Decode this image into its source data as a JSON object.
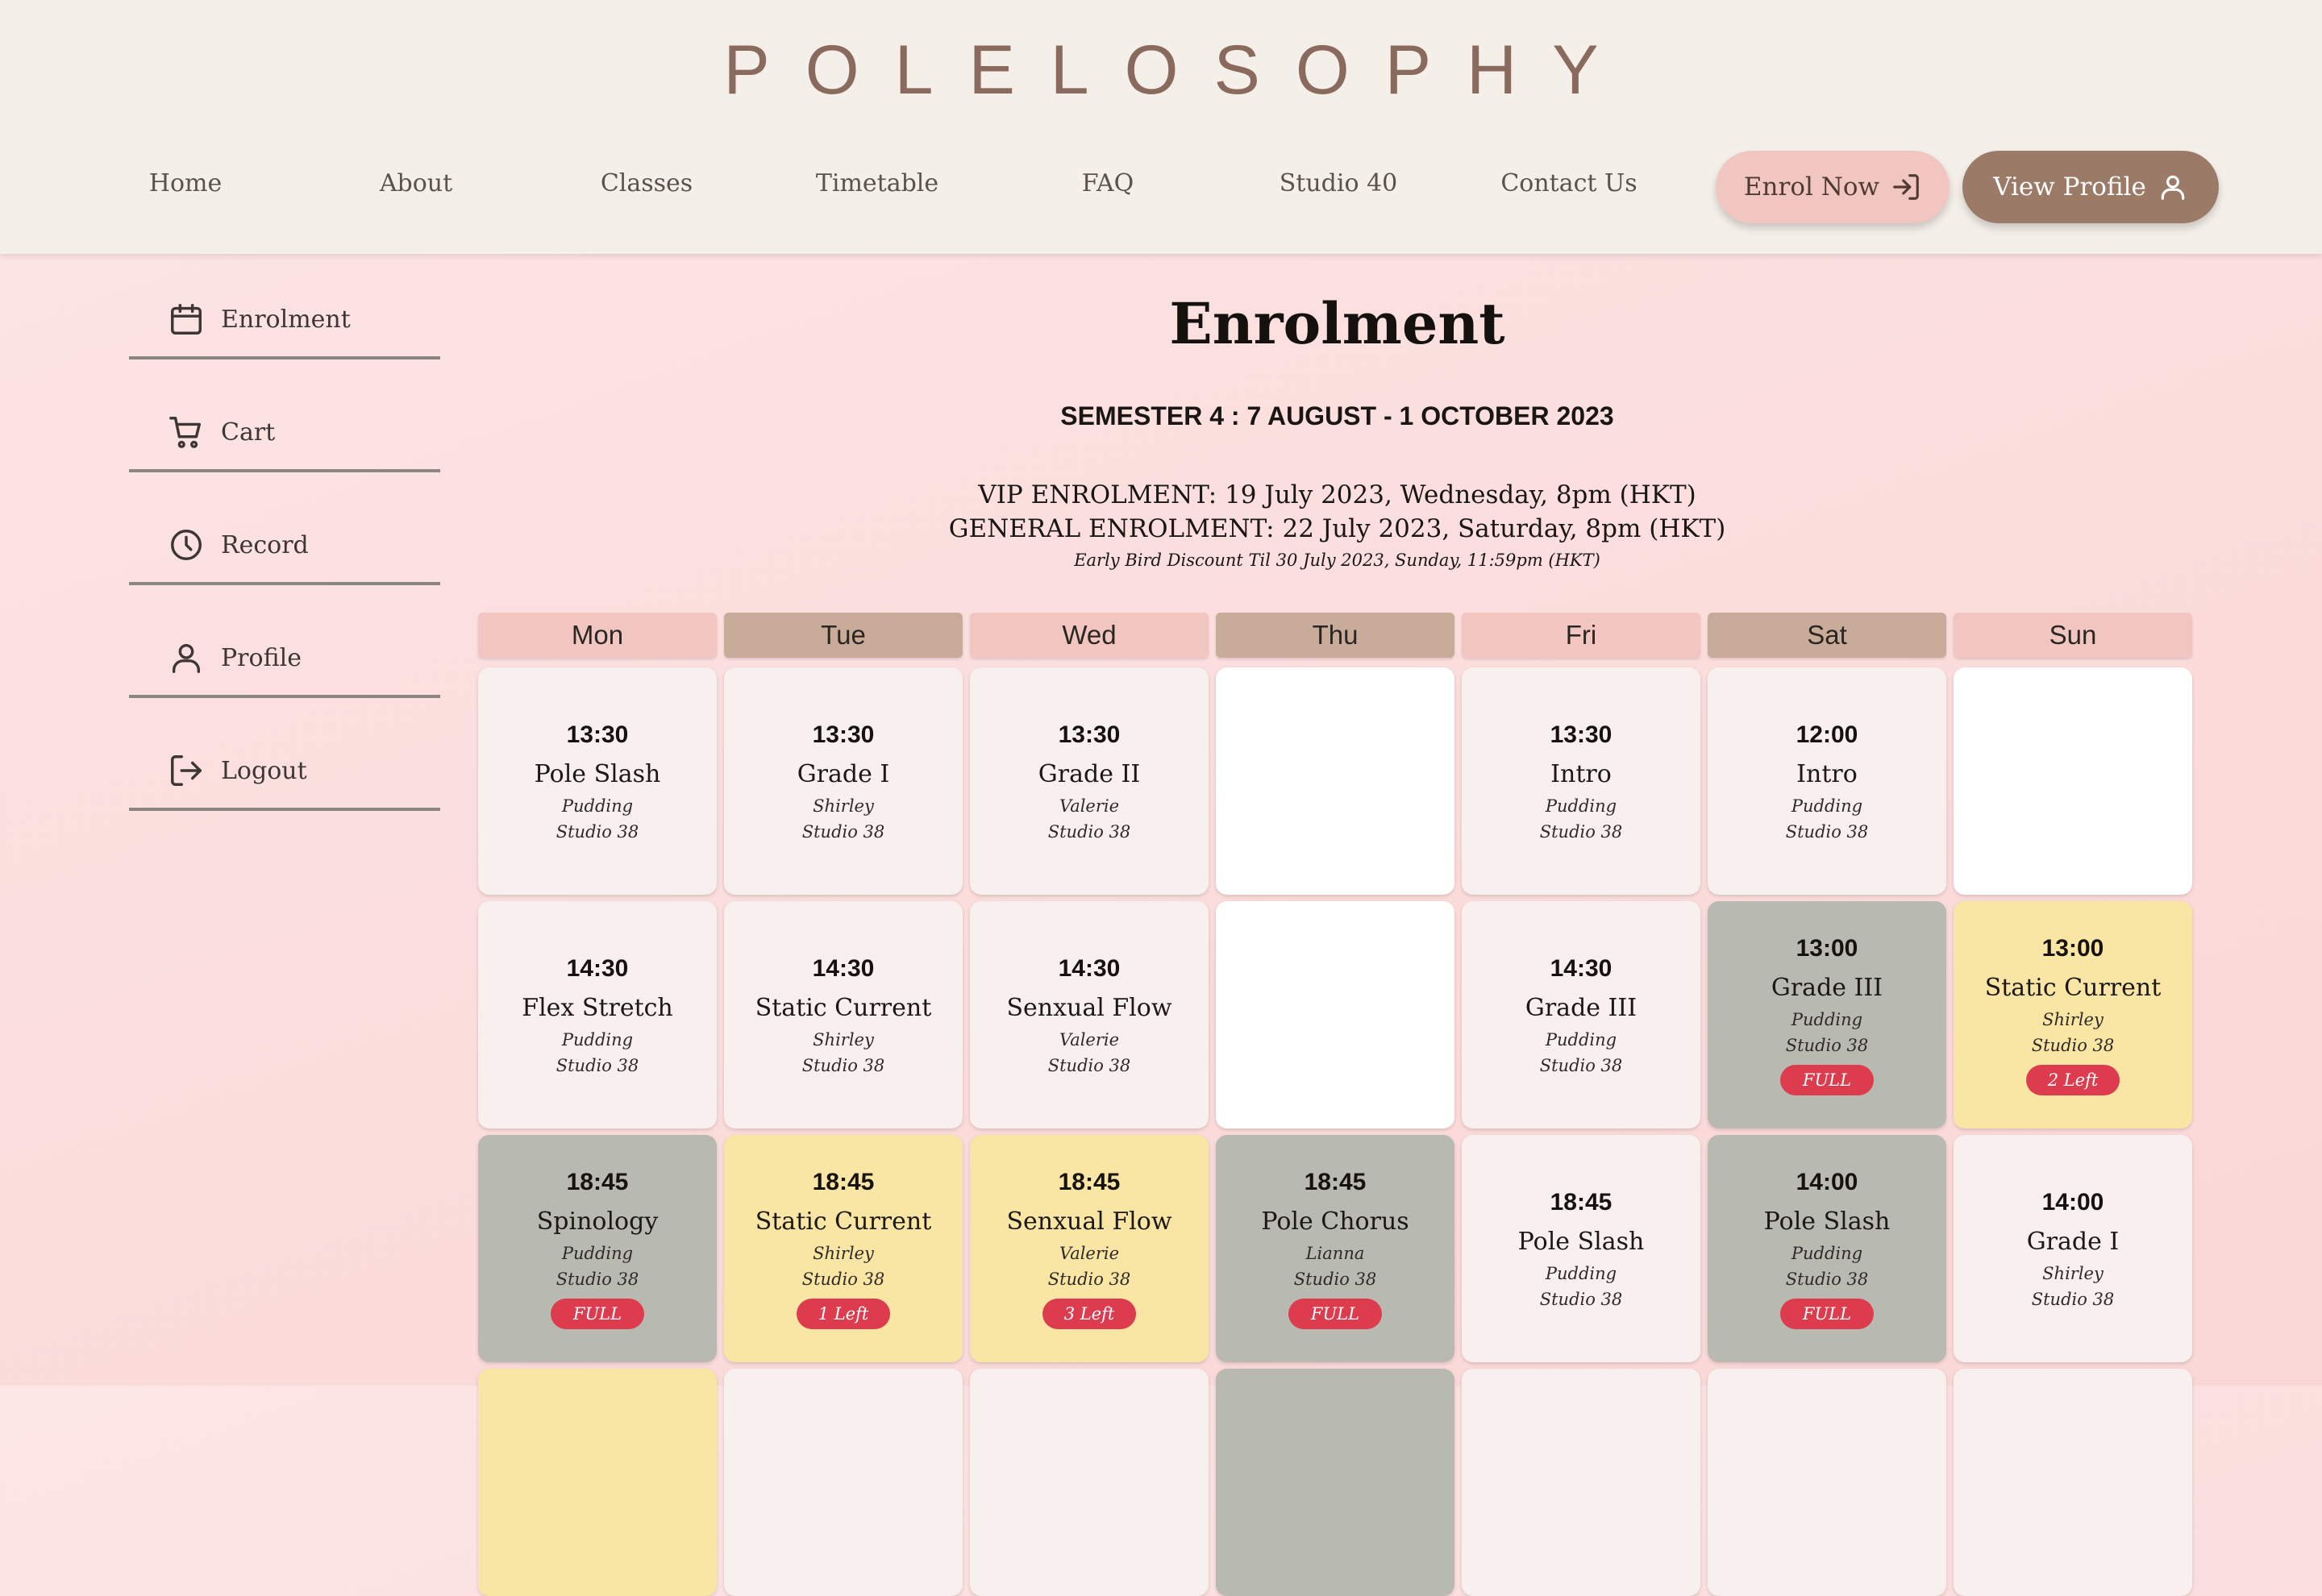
{
  "brand": {
    "logo_text": "POLELOSOPHY"
  },
  "nav": {
    "items": [
      "Home",
      "About",
      "Classes",
      "Timetable",
      "FAQ",
      "Studio 40",
      "Contact Us"
    ],
    "enrol_label": "Enrol Now",
    "enrol_icon": "login-arrow-icon",
    "profile_label": "View Profile",
    "profile_icon": "user-icon"
  },
  "sidebar": {
    "items": [
      {
        "label": "Enrolment",
        "icon": "calendar-icon"
      },
      {
        "label": "Cart",
        "icon": "cart-icon"
      },
      {
        "label": "Record",
        "icon": "clock-icon"
      },
      {
        "label": "Profile",
        "icon": "user-icon"
      },
      {
        "label": "Logout",
        "icon": "logout-icon"
      }
    ]
  },
  "main": {
    "title": "Enrolment",
    "semester": "SEMESTER 4 : 7 AUGUST - 1 OCTOBER 2023",
    "vip": "VIP ENROLMENT: 19 July 2023, Wednesday, 8pm (HKT)",
    "general": "GENERAL ENROLMENT: 22 July 2023, Saturday, 8pm (HKT)",
    "early_bird": "Early Bird Discount Til 30 July 2023, Sunday, 11:59pm (HKT)"
  },
  "colors": {
    "header_bg": "#f5efe9",
    "day_header_pink": "#f2c6c0",
    "day_header_tan": "#c8ab98",
    "cell_open": "#f8f0ef",
    "cell_full": "#b8b9b0",
    "cell_few": "#f9e6a4",
    "badge": "#dc3c4e",
    "accent_brown": "#9c7a68"
  },
  "timetable": {
    "days": [
      "Mon",
      "Tue",
      "Wed",
      "Thu",
      "Fri",
      "Sat",
      "Sun"
    ],
    "rows": [
      [
        {
          "time": "13:30",
          "name": "Pole Slash",
          "teacher": "Pudding",
          "studio": "Studio 38",
          "status": "open",
          "badge": ""
        },
        {
          "time": "13:30",
          "name": "Grade I",
          "teacher": "Shirley",
          "studio": "Studio 38",
          "status": "open",
          "badge": ""
        },
        {
          "time": "13:30",
          "name": "Grade II",
          "teacher": "Valerie",
          "studio": "Studio 38",
          "status": "open",
          "badge": ""
        },
        null,
        {
          "time": "13:30",
          "name": "Intro",
          "teacher": "Pudding",
          "studio": "Studio 38",
          "status": "open",
          "badge": ""
        },
        {
          "time": "12:00",
          "name": "Intro",
          "teacher": "Pudding",
          "studio": "Studio 38",
          "status": "open",
          "badge": ""
        },
        null
      ],
      [
        {
          "time": "14:30",
          "name": "Flex Stretch",
          "teacher": "Pudding",
          "studio": "Studio 38",
          "status": "open",
          "badge": ""
        },
        {
          "time": "14:30",
          "name": "Static Current",
          "teacher": "Shirley",
          "studio": "Studio 38",
          "status": "open",
          "badge": ""
        },
        {
          "time": "14:30",
          "name": "Senxual Flow",
          "teacher": "Valerie",
          "studio": "Studio 38",
          "status": "open",
          "badge": ""
        },
        null,
        {
          "time": "14:30",
          "name": "Grade III",
          "teacher": "Pudding",
          "studio": "Studio 38",
          "status": "open",
          "badge": ""
        },
        {
          "time": "13:00",
          "name": "Grade III",
          "teacher": "Pudding",
          "studio": "Studio 38",
          "status": "full",
          "badge": "FULL"
        },
        {
          "time": "13:00",
          "name": "Static Current",
          "teacher": "Shirley",
          "studio": "Studio 38",
          "status": "few",
          "badge": "2 Left"
        }
      ],
      [
        {
          "time": "18:45",
          "name": "Spinology",
          "teacher": "Pudding",
          "studio": "Studio 38",
          "status": "full",
          "badge": "FULL"
        },
        {
          "time": "18:45",
          "name": "Static Current",
          "teacher": "Shirley",
          "studio": "Studio 38",
          "status": "few",
          "badge": "1 Left"
        },
        {
          "time": "18:45",
          "name": "Senxual Flow",
          "teacher": "Valerie",
          "studio": "Studio 38",
          "status": "few",
          "badge": "3 Left"
        },
        {
          "time": "18:45",
          "name": "Pole Chorus",
          "teacher": "Lianna",
          "studio": "Studio 38",
          "status": "full",
          "badge": "FULL"
        },
        {
          "time": "18:45",
          "name": "Pole Slash",
          "teacher": "Pudding",
          "studio": "Studio 38",
          "status": "open",
          "badge": ""
        },
        {
          "time": "14:00",
          "name": "Pole Slash",
          "teacher": "Pudding",
          "studio": "Studio 38",
          "status": "full",
          "badge": "FULL"
        },
        {
          "time": "14:00",
          "name": "Grade I",
          "teacher": "Shirley",
          "studio": "Studio 38",
          "status": "open",
          "badge": ""
        }
      ],
      [
        {
          "time": "",
          "name": "",
          "teacher": "",
          "studio": "",
          "status": "few",
          "badge": ""
        },
        {
          "time": "",
          "name": "",
          "teacher": "",
          "studio": "",
          "status": "open",
          "badge": ""
        },
        {
          "time": "",
          "name": "",
          "teacher": "",
          "studio": "",
          "status": "open",
          "badge": ""
        },
        {
          "time": "",
          "name": "",
          "teacher": "",
          "studio": "",
          "status": "full",
          "badge": ""
        },
        {
          "time": "",
          "name": "",
          "teacher": "",
          "studio": "",
          "status": "open",
          "badge": ""
        },
        {
          "time": "",
          "name": "",
          "teacher": "",
          "studio": "",
          "status": "open",
          "badge": ""
        },
        {
          "time": "",
          "name": "",
          "teacher": "",
          "studio": "",
          "status": "open",
          "badge": ""
        }
      ]
    ]
  }
}
